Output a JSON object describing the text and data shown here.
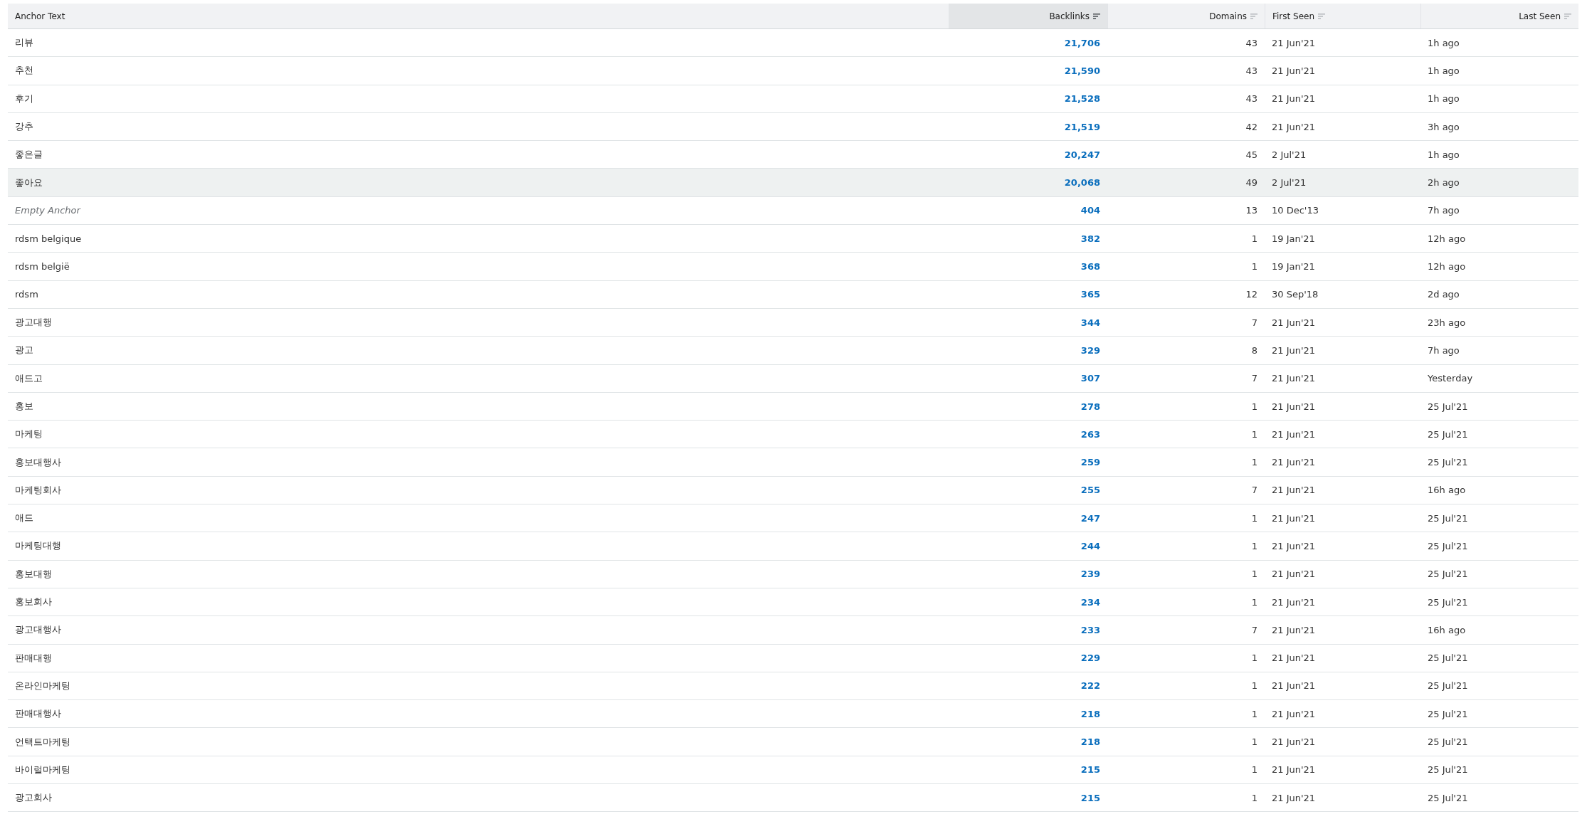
{
  "table": {
    "columns": [
      {
        "label": "Anchor Text",
        "sortable": false,
        "sorted": false
      },
      {
        "label": "Backlinks",
        "sortable": true,
        "sorted": true
      },
      {
        "label": "Domains",
        "sortable": true,
        "sorted": false
      },
      {
        "label": "First Seen",
        "sortable": true,
        "sorted": false
      },
      {
        "label": "Last Seen",
        "sortable": true,
        "sorted": false
      }
    ],
    "rows": [
      {
        "anchor": "리뷰",
        "empty": false,
        "hovered": false,
        "backlinks": "21,706",
        "domains": "43",
        "first_seen": "21 Jun'21",
        "last_seen": "1h ago"
      },
      {
        "anchor": "추천",
        "empty": false,
        "hovered": false,
        "backlinks": "21,590",
        "domains": "43",
        "first_seen": "21 Jun'21",
        "last_seen": "1h ago"
      },
      {
        "anchor": "후기",
        "empty": false,
        "hovered": false,
        "backlinks": "21,528",
        "domains": "43",
        "first_seen": "21 Jun'21",
        "last_seen": "1h ago"
      },
      {
        "anchor": "강추",
        "empty": false,
        "hovered": false,
        "backlinks": "21,519",
        "domains": "42",
        "first_seen": "21 Jun'21",
        "last_seen": "3h ago"
      },
      {
        "anchor": "좋은글",
        "empty": false,
        "hovered": false,
        "backlinks": "20,247",
        "domains": "45",
        "first_seen": "2 Jul'21",
        "last_seen": "1h ago"
      },
      {
        "anchor": "좋아요",
        "empty": false,
        "hovered": true,
        "backlinks": "20,068",
        "domains": "49",
        "first_seen": "2 Jul'21",
        "last_seen": "2h ago"
      },
      {
        "anchor": "Empty Anchor",
        "empty": true,
        "hovered": false,
        "backlinks": "404",
        "domains": "13",
        "first_seen": "10 Dec'13",
        "last_seen": "7h ago"
      },
      {
        "anchor": "rdsm belgique",
        "empty": false,
        "hovered": false,
        "backlinks": "382",
        "domains": "1",
        "first_seen": "19 Jan'21",
        "last_seen": "12h ago"
      },
      {
        "anchor": "rdsm belgië",
        "empty": false,
        "hovered": false,
        "backlinks": "368",
        "domains": "1",
        "first_seen": "19 Jan'21",
        "last_seen": "12h ago"
      },
      {
        "anchor": "rdsm",
        "empty": false,
        "hovered": false,
        "backlinks": "365",
        "domains": "12",
        "first_seen": "30 Sep'18",
        "last_seen": "2d ago"
      },
      {
        "anchor": "광고대행",
        "empty": false,
        "hovered": false,
        "backlinks": "344",
        "domains": "7",
        "first_seen": "21 Jun'21",
        "last_seen": "23h ago"
      },
      {
        "anchor": "광고",
        "empty": false,
        "hovered": false,
        "backlinks": "329",
        "domains": "8",
        "first_seen": "21 Jun'21",
        "last_seen": "7h ago"
      },
      {
        "anchor": "애드고",
        "empty": false,
        "hovered": false,
        "backlinks": "307",
        "domains": "7",
        "first_seen": "21 Jun'21",
        "last_seen": "Yesterday"
      },
      {
        "anchor": "홍보",
        "empty": false,
        "hovered": false,
        "backlinks": "278",
        "domains": "1",
        "first_seen": "21 Jun'21",
        "last_seen": "25 Jul'21"
      },
      {
        "anchor": "마케팅",
        "empty": false,
        "hovered": false,
        "backlinks": "263",
        "domains": "1",
        "first_seen": "21 Jun'21",
        "last_seen": "25 Jul'21"
      },
      {
        "anchor": "홍보대행사",
        "empty": false,
        "hovered": false,
        "backlinks": "259",
        "domains": "1",
        "first_seen": "21 Jun'21",
        "last_seen": "25 Jul'21"
      },
      {
        "anchor": "마케팅회사",
        "empty": false,
        "hovered": false,
        "backlinks": "255",
        "domains": "7",
        "first_seen": "21 Jun'21",
        "last_seen": "16h ago"
      },
      {
        "anchor": "애드",
        "empty": false,
        "hovered": false,
        "backlinks": "247",
        "domains": "1",
        "first_seen": "21 Jun'21",
        "last_seen": "25 Jul'21"
      },
      {
        "anchor": "마케팅대행",
        "empty": false,
        "hovered": false,
        "backlinks": "244",
        "domains": "1",
        "first_seen": "21 Jun'21",
        "last_seen": "25 Jul'21"
      },
      {
        "anchor": "홍보대행",
        "empty": false,
        "hovered": false,
        "backlinks": "239",
        "domains": "1",
        "first_seen": "21 Jun'21",
        "last_seen": "25 Jul'21"
      },
      {
        "anchor": "홍보회사",
        "empty": false,
        "hovered": false,
        "backlinks": "234",
        "domains": "1",
        "first_seen": "21 Jun'21",
        "last_seen": "25 Jul'21"
      },
      {
        "anchor": "광고대행사",
        "empty": false,
        "hovered": false,
        "backlinks": "233",
        "domains": "7",
        "first_seen": "21 Jun'21",
        "last_seen": "16h ago"
      },
      {
        "anchor": "판매대행",
        "empty": false,
        "hovered": false,
        "backlinks": "229",
        "domains": "1",
        "first_seen": "21 Jun'21",
        "last_seen": "25 Jul'21"
      },
      {
        "anchor": "온라인마케팅",
        "empty": false,
        "hovered": false,
        "backlinks": "222",
        "domains": "1",
        "first_seen": "21 Jun'21",
        "last_seen": "25 Jul'21"
      },
      {
        "anchor": "판매대행사",
        "empty": false,
        "hovered": false,
        "backlinks": "218",
        "domains": "1",
        "first_seen": "21 Jun'21",
        "last_seen": "25 Jul'21"
      },
      {
        "anchor": "언택트마케팅",
        "empty": false,
        "hovered": false,
        "backlinks": "218",
        "domains": "1",
        "first_seen": "21 Jun'21",
        "last_seen": "25 Jul'21"
      },
      {
        "anchor": "바이럴마케팅",
        "empty": false,
        "hovered": false,
        "backlinks": "215",
        "domains": "1",
        "first_seen": "21 Jun'21",
        "last_seen": "25 Jul'21"
      },
      {
        "anchor": "광고회사",
        "empty": false,
        "hovered": false,
        "backlinks": "215",
        "domains": "1",
        "first_seen": "21 Jun'21",
        "last_seen": "25 Jul'21"
      }
    ]
  }
}
